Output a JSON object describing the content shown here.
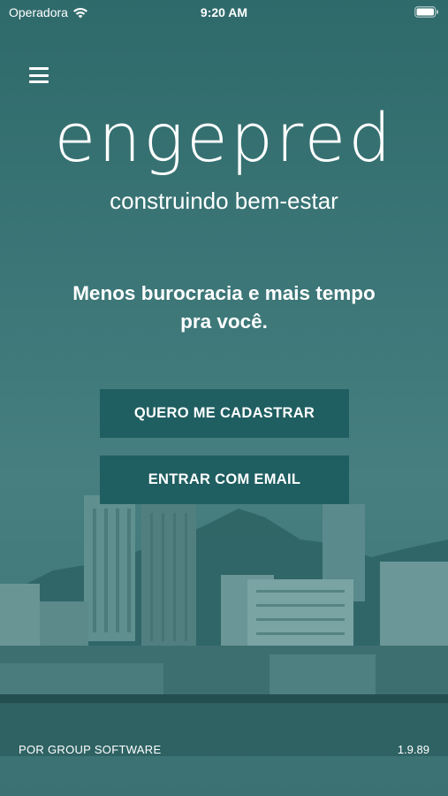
{
  "status_bar": {
    "carrier": "Operadora",
    "time": "9:20 AM",
    "icons": [
      "wifi-icon",
      "battery-icon"
    ]
  },
  "header": {
    "menu_icon": "hamburger-menu-icon"
  },
  "brand": {
    "logo_text": "engepred",
    "tagline": "construindo bem-estar"
  },
  "main": {
    "headline_line1": "Menos burocracia e mais tempo",
    "headline_line2": "pra você.",
    "register_button_label": "QUERO ME CADASTRAR",
    "email_button_label": "ENTRAR COM EMAIL"
  },
  "footer": {
    "credit": "POR GROUP SOFTWARE",
    "version": "1.9.89"
  },
  "colors": {
    "background": "#3c7677",
    "button": "#1f5e61",
    "text": "#ffffff"
  }
}
